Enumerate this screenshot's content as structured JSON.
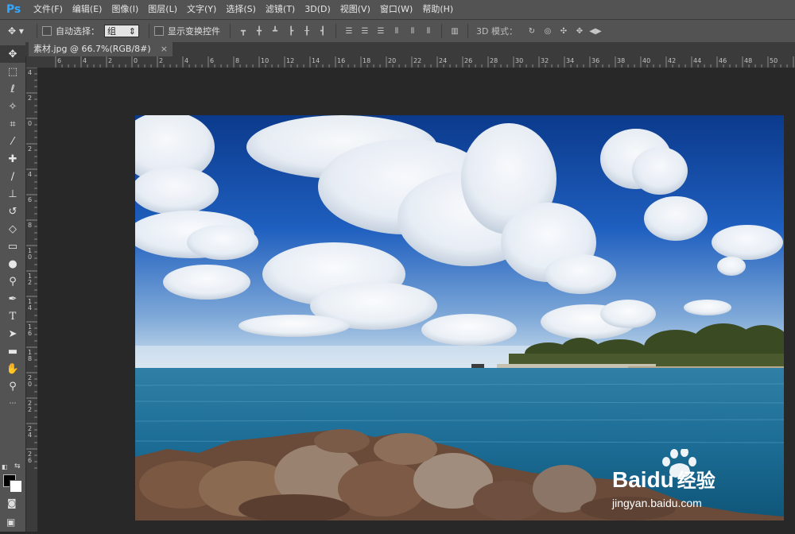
{
  "app": {
    "logo": "Ps"
  },
  "menu": [
    "文件(F)",
    "编辑(E)",
    "图像(I)",
    "图层(L)",
    "文字(Y)",
    "选择(S)",
    "滤镜(T)",
    "3D(D)",
    "视图(V)",
    "窗口(W)",
    "帮助(H)"
  ],
  "options": {
    "auto_select_label": "自动选择：",
    "auto_select_value": "组",
    "show_transform_label": "显示变换控件",
    "mode_3d_label": "3D 模式："
  },
  "document": {
    "tab_title": "素材.jpg @ 66.7%(RGB/8#)",
    "close_glyph": "×"
  },
  "ruler": {
    "top_ticks": [
      "6",
      "4",
      "2",
      "0",
      "2",
      "4",
      "6",
      "8",
      "10",
      "12",
      "14",
      "16",
      "18",
      "20",
      "22",
      "24",
      "26",
      "28",
      "30",
      "32",
      "34",
      "36",
      "38",
      "40",
      "42",
      "44",
      "46",
      "48",
      "50",
      "52"
    ],
    "left_ticks": [
      "4",
      "2",
      "0",
      "2",
      "4",
      "6",
      "8",
      "10",
      "12",
      "14",
      "16",
      "18",
      "20",
      "22",
      "24",
      "26"
    ]
  },
  "watermark": {
    "brand_latin": "Bai",
    "brand_du": "du",
    "brand_cn": "经验",
    "url": "jingyan.baidu.com"
  },
  "colors": {
    "accent": "#31a8ff",
    "panel": "#535353",
    "workspace": "#282828"
  }
}
